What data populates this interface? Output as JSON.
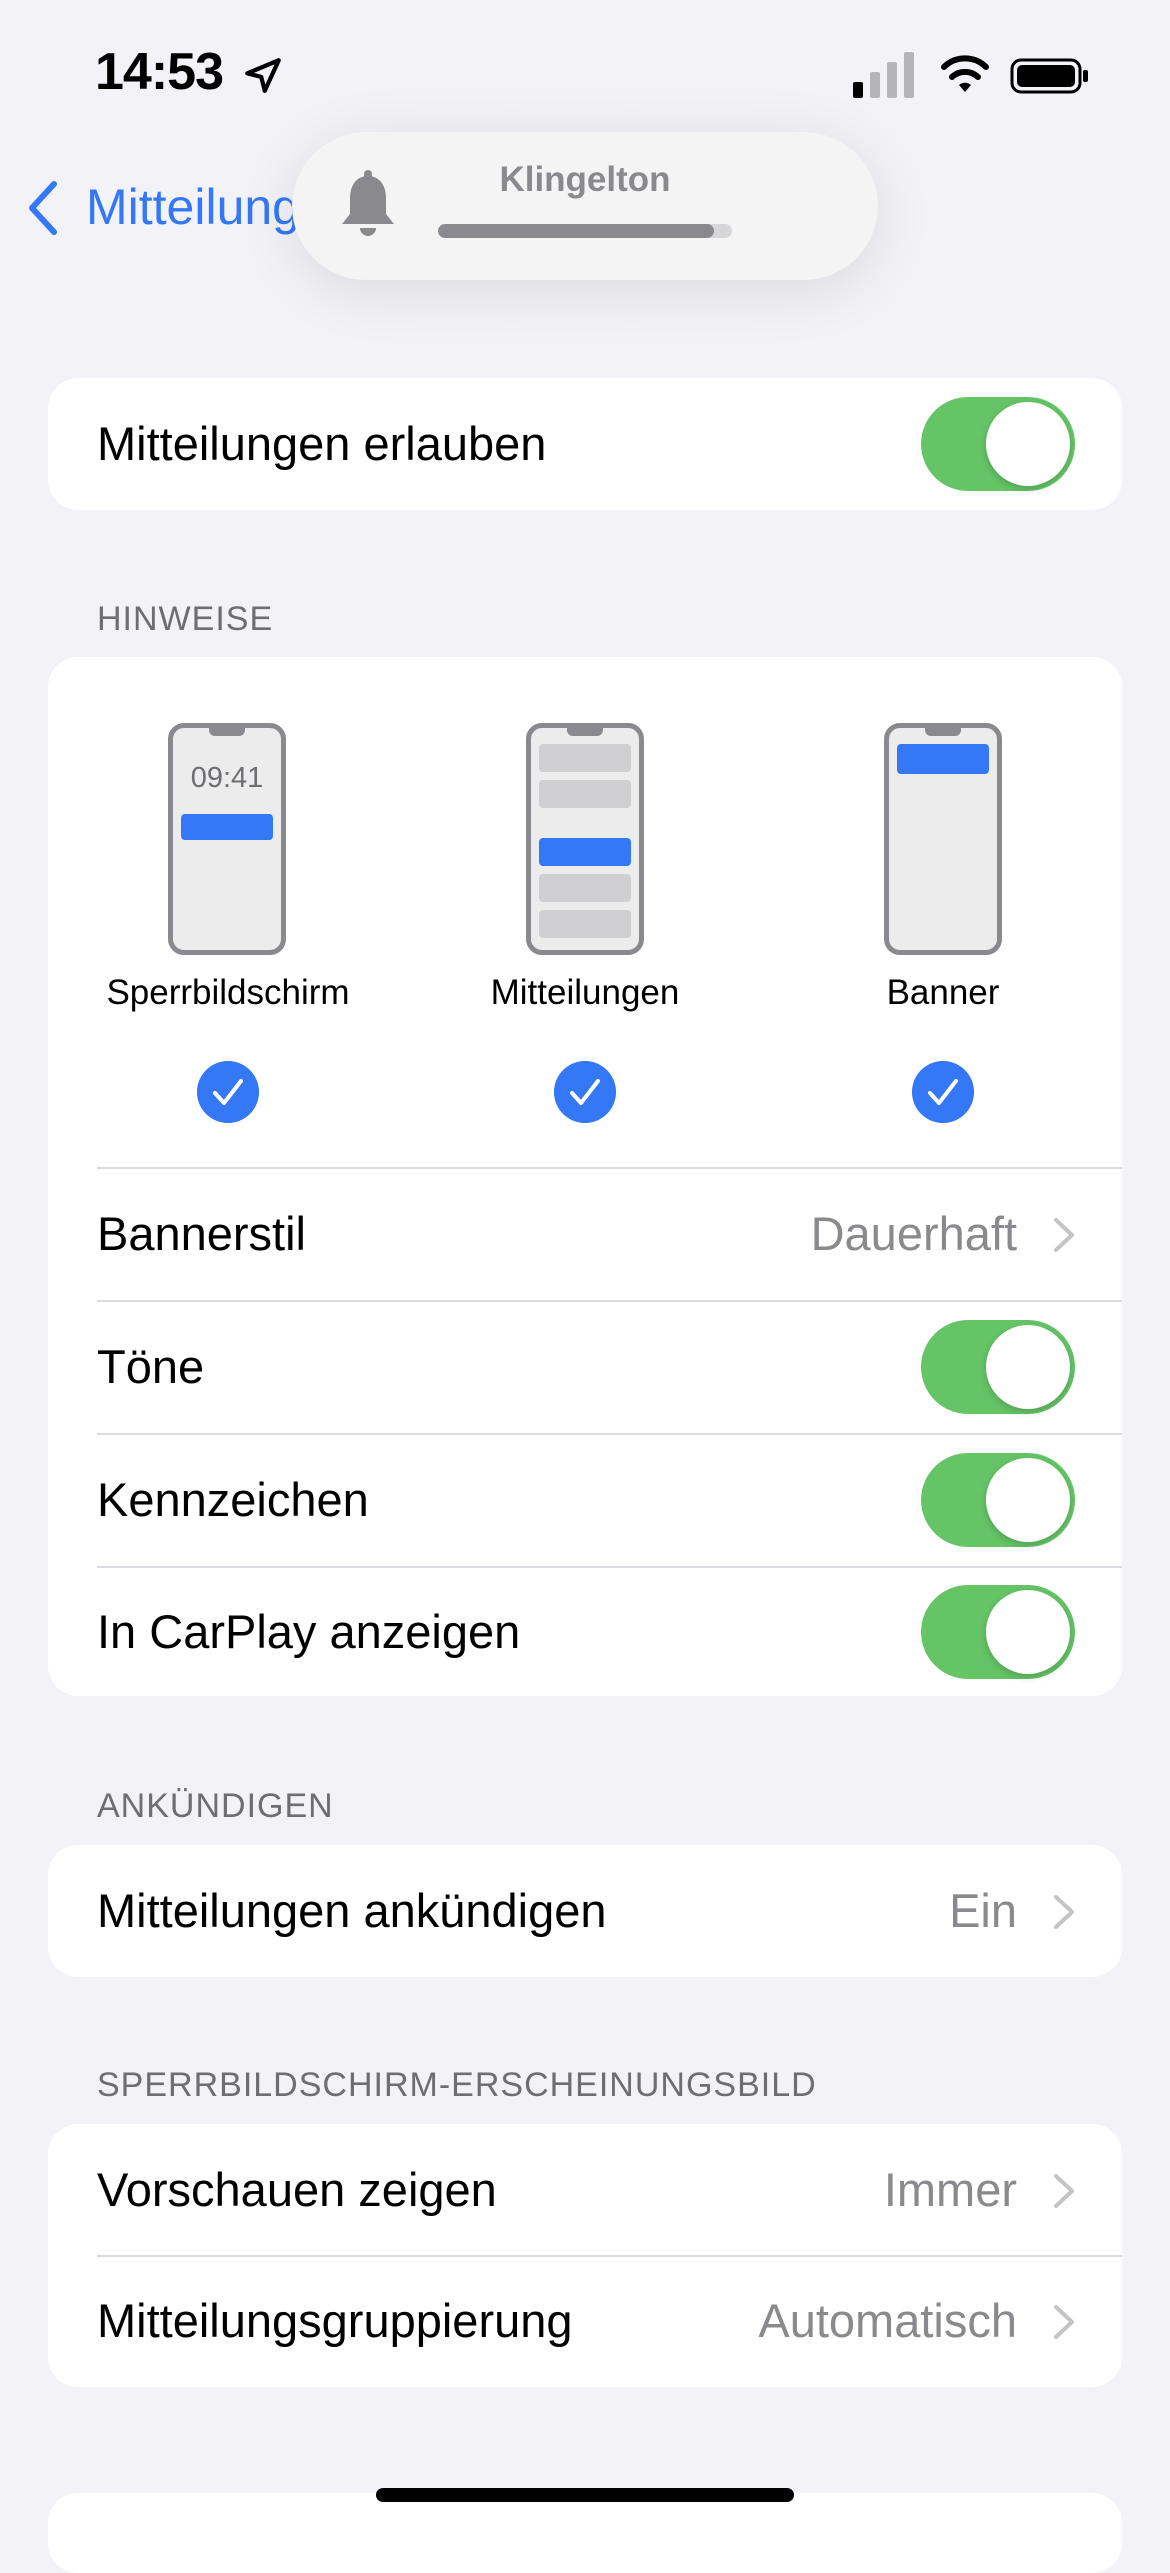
{
  "status_bar": {
    "time": "14:53"
  },
  "nav": {
    "back_label": "Mitteilungen"
  },
  "hud": {
    "title": "Klingelton",
    "level": 0.94
  },
  "allow": {
    "label": "Mitteilungen erlauben",
    "on": true
  },
  "alerts": {
    "header": "HINWEISE",
    "options": [
      {
        "label": "Sperrbildschirm",
        "time": "09:41",
        "checked": true
      },
      {
        "label": "Mitteilungen",
        "checked": true
      },
      {
        "label": "Banner",
        "checked": true
      }
    ],
    "rows": [
      {
        "label": "Bannerstil",
        "value": "Dauerhaft"
      },
      {
        "label": "Töne",
        "on": true
      },
      {
        "label": "Kennzeichen",
        "on": true
      },
      {
        "label": "In CarPlay anzeigen",
        "on": true
      }
    ]
  },
  "announce": {
    "header": "ANKÜNDIGEN",
    "row": {
      "label": "Mitteilungen ankündigen",
      "value": "Ein"
    }
  },
  "lockscreen": {
    "header": "SPERRBILDSCHIRM-ERSCHEINUNGSBILD",
    "rows": [
      {
        "label": "Vorschauen zeigen",
        "value": "Immer"
      },
      {
        "label": "Mitteilungsgruppierung",
        "value": "Automatisch"
      }
    ]
  },
  "colors": {
    "accent": "#3478f6",
    "toggle_on": "#65c466",
    "background": "#f2f2f7",
    "secondary_text": "#8a8a8e"
  }
}
